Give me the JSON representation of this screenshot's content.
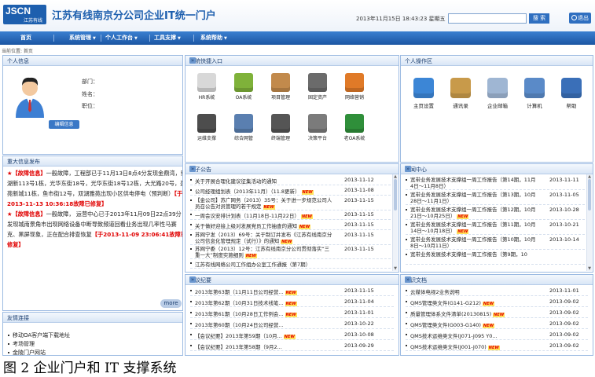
{
  "header": {
    "logo_text": "JSCN",
    "logo_subtext": "江苏有线",
    "title": "江苏有线南京分公司企业IT统一门户",
    "datetime": "2013年11月15日  18:43:23 星期五",
    "search_placeholder": "",
    "search_label": "搜 索",
    "exit_label": "退出"
  },
  "nav": {
    "items": [
      {
        "label": "首页",
        "has_dropdown": false
      },
      {
        "label": "系统管理",
        "has_dropdown": true
      },
      {
        "label": "个人工作台",
        "has_dropdown": true
      },
      {
        "label": "工具支撑",
        "has_dropdown": true
      },
      {
        "label": "系统帮助",
        "has_dropdown": true
      }
    ]
  },
  "breadcrumb": "当前位置: 首页",
  "personal_info": {
    "title": "个人信息",
    "fields": [
      "部门：",
      "姓名：",
      "职位："
    ],
    "edit_label": "编辑信息"
  },
  "announcements": {
    "title": "重大信息发布",
    "items": [
      {
        "tag": "★【故障信息】",
        "text": "一般故障，工程部已于11月13日8点4分发现金鼎湾，鄢湖新113号1栋，光华东街18号，光华东街18号12栋，大光路20号，盈苑新城11栋，鱼市街12号，双湖雅苑出现小区供电停电（预判断）",
        "highlight": "【于2013-11-13 10:36:18故障已修复】"
      },
      {
        "tag": "★【故障信息】",
        "text": "一般故障，  运营中心已于2013年11月09日22点39分发现城南景角市出现网络设备中断导致频道回看业务出现几率性马赛克、黑屏现象，正在配合排查恢复",
        "highlight": "【于2013-11-09 23:06:41故障已修复】"
      }
    ],
    "more_label": "more"
  },
  "quick_links": {
    "title": "友情连接",
    "items": [
      "移动OA客户端下载地址",
      "考场管理",
      "金陵门户网站"
    ]
  },
  "system_entry": {
    "title": "系统快捷入口",
    "items": [
      {
        "label": "HR系统",
        "icon": "hr-icon",
        "color": "#d8d8d8"
      },
      {
        "label": "OA系统",
        "icon": "oa-icon",
        "color": "#7fb23a"
      },
      {
        "label": "项目管理",
        "icon": "project-icon",
        "color": "#c28a4c"
      },
      {
        "label": "固定资产",
        "icon": "asset-icon",
        "color": "#6b6b6b"
      },
      {
        "label": "网络营销",
        "icon": "marketing-icon",
        "color": "#e07a28"
      },
      {
        "label": "运维支撑",
        "icon": "ops-icon",
        "color": "#4d4d4d"
      },
      {
        "label": "综合网管",
        "icon": "network-icon",
        "color": "#5a7fb0"
      },
      {
        "label": "终端管理",
        "icon": "terminal-icon",
        "color": "#555555"
      },
      {
        "label": "决策平台",
        "icon": "decision-icon",
        "color": "#7b7b7b"
      },
      {
        "label": "老OA系统",
        "icon": "old-oa-icon",
        "color": "#2f8f3a"
      }
    ]
  },
  "personal_ops": {
    "title": "个人操作区",
    "items": [
      {
        "label": "主页设置",
        "icon": "homepage-settings-icon",
        "color": "#3c86d6"
      },
      {
        "label": "通讯录",
        "icon": "address-book-icon",
        "color": "#c89a4a"
      },
      {
        "label": "企业邮箱",
        "icon": "mail-icon",
        "color": "#9fb6d3"
      },
      {
        "label": "计算机",
        "icon": "calculator-icon",
        "color": "#5a8ac8"
      },
      {
        "label": "帮助",
        "icon": "help-icon",
        "color": "#3a6fb8"
      }
    ]
  },
  "news_notice": {
    "title": "电子公告",
    "items": [
      {
        "text": "关于开展合理化建议征集活动的通知",
        "date": "2013-11-12",
        "lines": 1
      },
      {
        "text": "公司经理组划表（2013年11月）（11.8更新）",
        "date": "2013-11-08",
        "lines": 1,
        "new": true
      },
      {
        "text": "【金公司】苏广网务（2013）35号：关于进一步规范公司人员召公告对员管理的若干规定",
        "date": "2013-11-15",
        "lines": 2,
        "new": true
      },
      {
        "text": "一周会议安排计划表（11月18日-11月22日）",
        "date": "2013-11-15",
        "lines": 1,
        "new": true
      },
      {
        "text": "关于做好迎接上级对发展党员工作抽查的通知",
        "date": "2013-11-15",
        "lines": 1,
        "new": true
      },
      {
        "text": "苏网宁发（2013）69号：关于制订并发布《江苏有线南京分公司信息化管理规定（试行）》的通知",
        "date": "2013-11-15",
        "lines": 2,
        "new": true
      },
      {
        "text": "苏网宁委（2013）12号：江苏有线南京分公司贯彻落实“三重一大”制度实施细则",
        "date": "2013-11-15",
        "lines": 2,
        "new": true
      },
      {
        "text": "江苏有线网络公司工作组办公室工作通报（第7期）",
        "date": "",
        "lines": 1
      }
    ]
  },
  "news_center": {
    "title": "新闻中心",
    "items": [
      {
        "text": "宽带业务发展技术支撑组一周工作报告（第14期，11月4日～11月8日）",
        "date": "2013-11-11"
      },
      {
        "text": "宽带业务发展技术支撑组一周工作报告（第13期，10月28日～11月1日）",
        "date": "2013-11-05"
      },
      {
        "text": "宽带业务发展技术支撑组一周工作报告（第12期，10月21日～10月25日）",
        "date": "2013-10-28",
        "new": true
      },
      {
        "text": "宽带业务发展技术支撑组一周工作报告（第11期，10月14日～10月18日）",
        "date": "2013-10-21",
        "new": true
      },
      {
        "text": "宽带业务发展技术支撑组一周工作报告（第10期，10月8日～10月11日）",
        "date": "2013-10-14"
      },
      {
        "text": "宽带业务发展技术支撑组一周工作报告（第9期，10",
        "date": ""
      }
    ]
  },
  "meeting_summary": {
    "title": "会议纪要",
    "items": [
      {
        "text": "2013年第63期（11月11日公司经营...",
        "date": "2013-11-15",
        "new": true
      },
      {
        "text": "2013年第62期（10月31日技术线笔...",
        "date": "2013-11-04",
        "new": true
      },
      {
        "text": "2013年第61期（10月28日工作例会...",
        "date": "2013-11-01",
        "new": true
      },
      {
        "text": "2013年第60期（10月24日公司经营...",
        "date": "2013-10-22"
      },
      {
        "text": "【会议纪要】2013年第59期（10月...",
        "date": "2013-10-08",
        "new": true
      },
      {
        "text": "【会议纪要】2013年第58期（9月2...",
        "date": "2013-09-29"
      }
    ]
  },
  "knowledge_docs": {
    "title": "知识文档",
    "items": [
      {
        "text": "云媒体电视2业务说明",
        "date": "2013-11-01"
      },
      {
        "text": "QMS管理类文件(G141-G212)",
        "date": "2013-09-02",
        "new": true
      },
      {
        "text": "质量管理体系文件清单(20130815)",
        "date": "2013-09-02",
        "new": true
      },
      {
        "text": "QMS管理类文件(G003-G140)",
        "date": "2013-09-02",
        "new": true
      },
      {
        "text": "QMS技术运维类文件(J071-J095 Y0...",
        "date": "2013-09-02"
      },
      {
        "text": "QMS技术运维类文件(J001-J070)",
        "date": "2013-09-02",
        "new": true
      }
    ]
  },
  "caption": "图 2  企业门户和 IT 支撑系统",
  "labels": {
    "new": "NEW"
  }
}
